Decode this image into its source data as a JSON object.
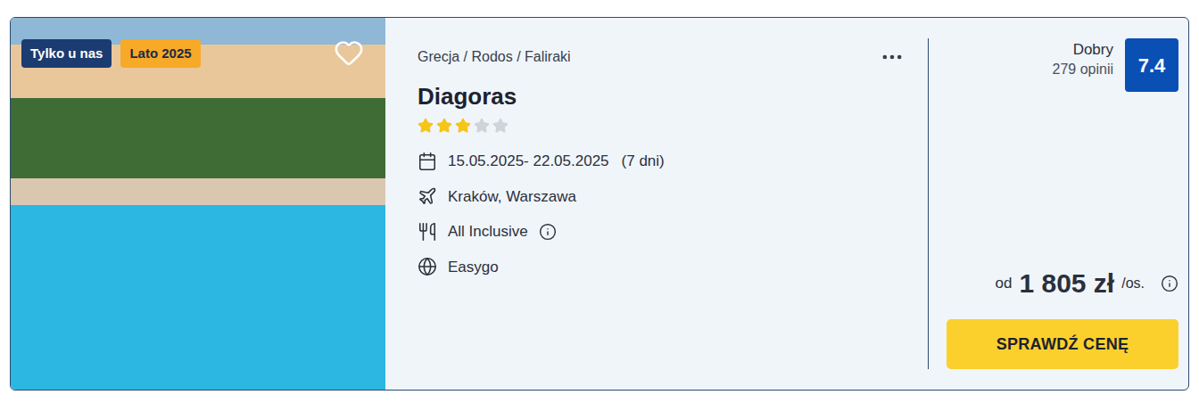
{
  "badges": [
    {
      "label": "Tylko u nas",
      "color": "#1c3b70",
      "text_color": "#ffffff"
    },
    {
      "label": "Lato 2025",
      "color": "#f7a928",
      "text_color": "#1c2b45"
    }
  ],
  "favorite": false,
  "location": "Grecja / Rodos / Faliraki",
  "hotel": {
    "name": "Diagoras",
    "stars": 3,
    "stars_total": 5
  },
  "details": [
    {
      "kind": "dates",
      "text": "15.05.2025- 22.05.2025",
      "extra": "(7 dni)",
      "info": false
    },
    {
      "kind": "departure",
      "text": "Kraków, Warszawa",
      "extra": "",
      "info": false
    },
    {
      "kind": "board",
      "text": "All Inclusive",
      "extra": "",
      "info": true
    },
    {
      "kind": "operator",
      "text": "Easygo",
      "extra": "",
      "info": false
    }
  ],
  "rating": {
    "label": "Dobry",
    "reviews": "279 opinii",
    "score": "7.4"
  },
  "price": {
    "prefix": "od",
    "amount": "1 805 zł",
    "suffix": "/os."
  },
  "button": "SPRAWDŹ CENĘ"
}
